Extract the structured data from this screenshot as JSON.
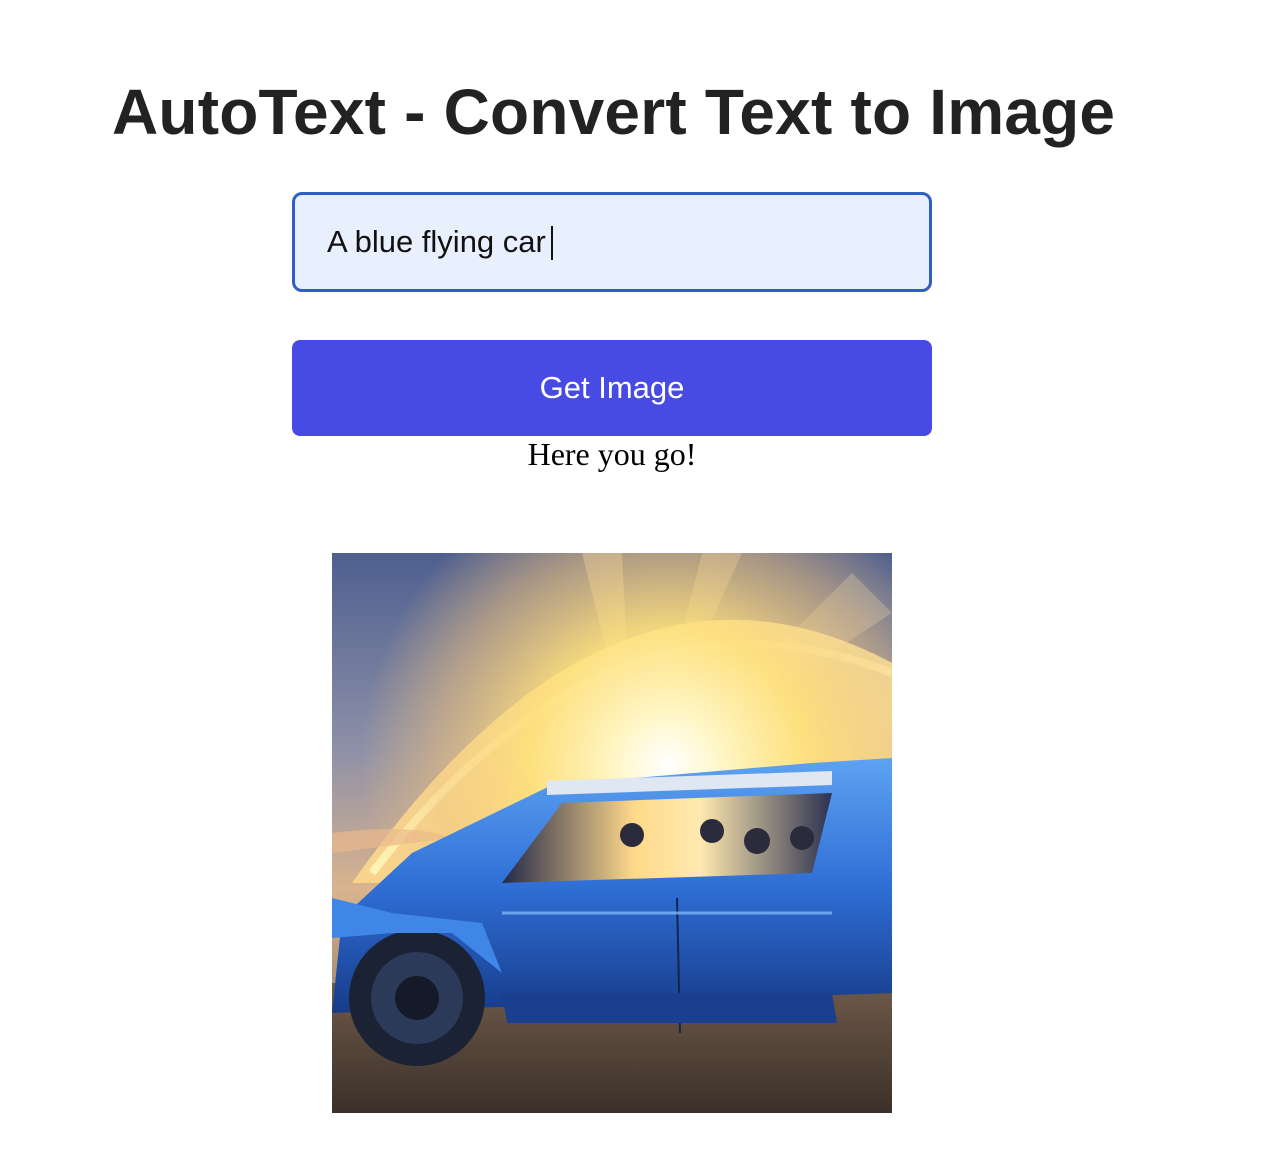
{
  "header": {
    "title": "AutoText - Convert Text to Image"
  },
  "form": {
    "prompt_value": "A blue flying car",
    "button_label": "Get Image"
  },
  "result": {
    "status_text": "Here you go!",
    "image_subject": "generated-image"
  },
  "colors": {
    "title": "#222222",
    "input_border": "#2f5fc4",
    "input_background": "#e8f0fe",
    "button_background": "#474be3",
    "button_text": "#ffffff"
  }
}
